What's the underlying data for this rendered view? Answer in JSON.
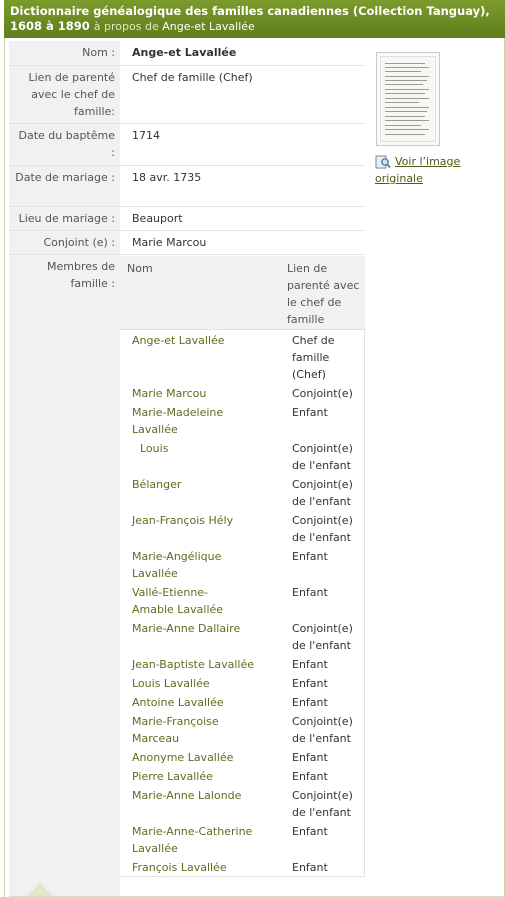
{
  "header": {
    "title": "Dictionnaire généalogique des familles canadiennes (Collection Tanguay), 1608 à 1890",
    "about_prefix": "à propos de",
    "subject_name": "Ange-et Lavallée"
  },
  "record": {
    "fields": [
      {
        "label": "Nom :",
        "value": "Ange-et Lavallée"
      },
      {
        "label": "Lien de parenté avec le chef de famille:",
        "value": "Chef de famille (Chef)"
      },
      {
        "label": "Date du baptême :",
        "value": "1714"
      },
      {
        "label": "Date de mariage :",
        "value": "18 avr. 1735"
      },
      {
        "label": "Lieu de mariage :",
        "value": "Beauport"
      },
      {
        "label": "Conjoint (e) :",
        "value": "Marie Marcou"
      }
    ],
    "members_label": "Membres de famille :"
  },
  "members": {
    "col_name": "Nom",
    "col_relation": "Lien de parenté avec le chef de famille",
    "rows": [
      {
        "name": "Ange-et Lavallée",
        "relation": "Chef de famille (Chef)"
      },
      {
        "name": "Marie Marcou",
        "relation": "Conjoint(e)"
      },
      {
        "name": "Marie-Madeleine Lavallée",
        "relation": "Enfant"
      },
      {
        "name": "Louis",
        "relation": "Conjoint(e) de l'enfant"
      },
      {
        "name": "Bélanger",
        "relation": "Conjoint(e) de l'enfant"
      },
      {
        "name": "Jean-François Hély",
        "relation": "Conjoint(e) de l'enfant"
      },
      {
        "name": "Marie-Angélique Lavallée",
        "relation": "Enfant"
      },
      {
        "name": "Vallé-Etienne-Amable Lavallée",
        "relation": "Enfant"
      },
      {
        "name": "Marie-Anne Dallaire",
        "relation": "Conjoint(e) de l'enfant"
      },
      {
        "name": "Jean-Baptiste Lavallée",
        "relation": "Enfant"
      },
      {
        "name": "Louis Lavallée",
        "relation": "Enfant"
      },
      {
        "name": "Antoine Lavallée",
        "relation": "Enfant"
      },
      {
        "name": "Marie-Françoise Marceau",
        "relation": "Conjoint(e) de l'enfant"
      },
      {
        "name": "Anonyme Lavallée",
        "relation": "Enfant"
      },
      {
        "name": "Pierre Lavallée",
        "relation": "Enfant"
      },
      {
        "name": "Marie-Anne Lalonde",
        "relation": "Conjoint(e) de l'enfant"
      },
      {
        "name": "Marie-Anne-Catherine Lavallée",
        "relation": "Enfant"
      },
      {
        "name": "François Lavallée",
        "relation": "Enfant"
      }
    ]
  },
  "image_panel": {
    "link_text": "Voir l’image originale",
    "icon": "magnifier-document-icon"
  },
  "colors": {
    "header_bg": "#6b8a24",
    "link": "#5a6f1e",
    "label_bg": "#f1f1f1"
  }
}
